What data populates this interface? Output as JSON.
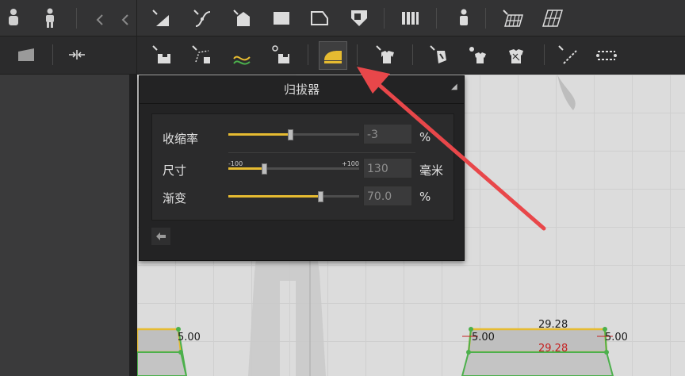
{
  "toolbar": {
    "row1_icons": [
      "avatar-icon",
      "avatar-2-icon",
      "collapse-left-icon",
      "collapse-left-2-icon",
      "segment-line-icon",
      "curve-point-icon",
      "pattern-edit-icon",
      "rectangle-icon",
      "polygon-icon",
      "internal-shape-icon",
      "stripe-icon",
      "pinning-icon",
      "grid-pattern-icon",
      "grid-skew-icon"
    ],
    "row2_icons": [
      "sewing-segment-icon",
      "sewing-free-icon",
      "sewing-curve-icon",
      "sewing-edit-icon",
      "shrinkage-iron-icon",
      "garment-icon",
      "garment-edit-icon",
      "avatar-fit-icon",
      "texture-icon",
      "line-draw-icon",
      "line-dash-icon"
    ],
    "active_color": "#e6bb31"
  },
  "dialog": {
    "title": "归拔器",
    "rows": [
      {
        "label": "收缩率",
        "value": "-3",
        "unit": "%",
        "fraction": 0.47,
        "tick_min": "-100",
        "tick_max": "+100"
      },
      {
        "label": "尺寸",
        "value": "130",
        "unit": "毫米",
        "fraction": 0.27
      },
      {
        "label": "渐变",
        "value": "70.0",
        "unit": "%",
        "fraction": 0.7
      }
    ]
  },
  "viewport": {
    "measurements": {
      "left_edge": "5.00",
      "right_left": "5.00",
      "right_right": "5.00",
      "top_width": "29.28",
      "inner_width": "29.28"
    }
  }
}
